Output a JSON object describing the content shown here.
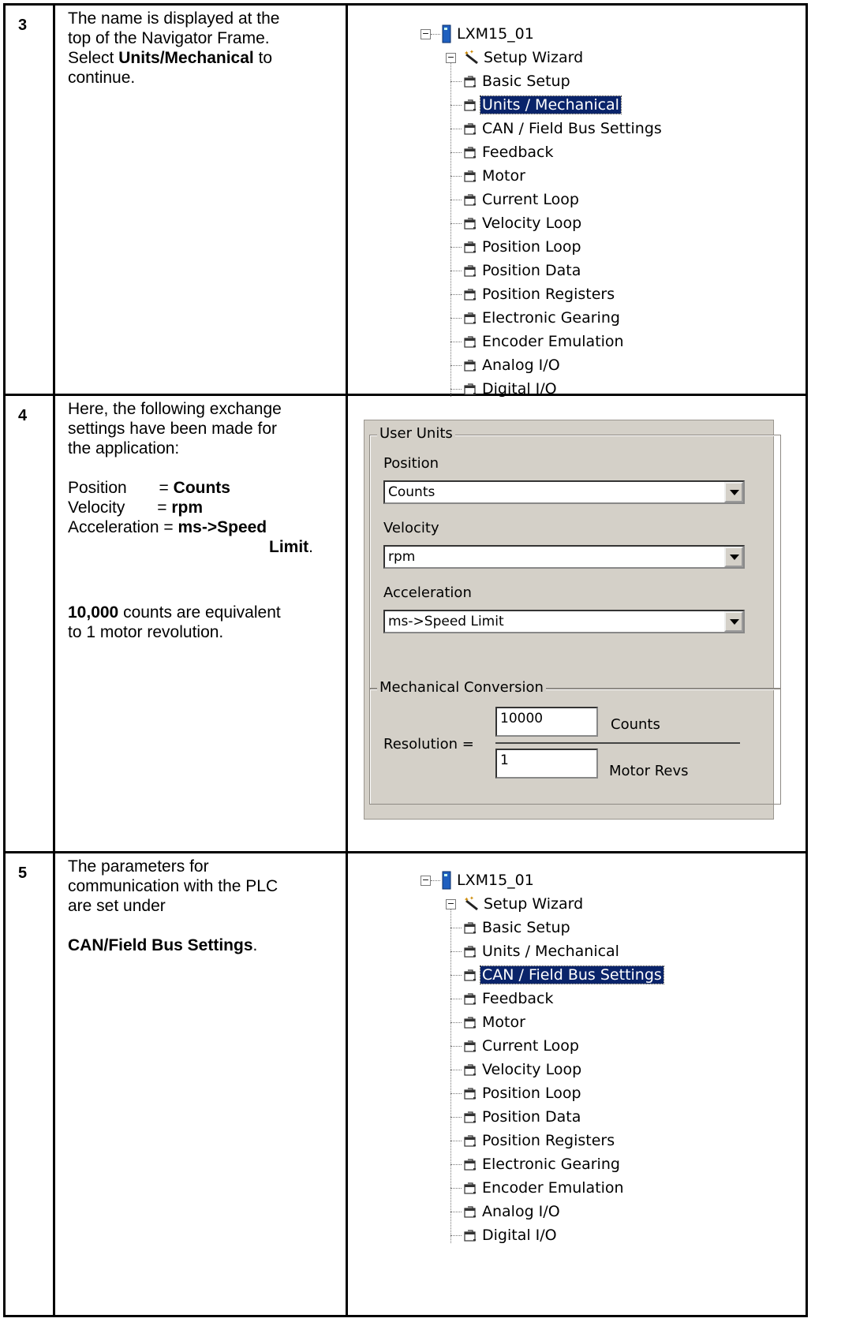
{
  "steps": [
    {
      "number": "3",
      "lines": [
        "The name is displayed at the",
        "top of the Navigator Frame.",
        "Select "
      ],
      "select_bold": "Units/Mechanical",
      "select_after": " to",
      "last": "continue."
    },
    {
      "number": "4",
      "intro": [
        "Here, the following exchange",
        "settings have been made for",
        "the application:"
      ],
      "settings": [
        {
          "key": "Position       = ",
          "value": "Counts"
        },
        {
          "key": "Velocity       = ",
          "value": "rpm"
        },
        {
          "key": "Acceleration = ",
          "value": "ms->Speed"
        }
      ],
      "limit_bold": "Limit",
      "limit_after": ".",
      "counts_bold": "10,000",
      "counts_after": " counts are equivalent",
      "counts_line2": "to 1 motor revolution."
    },
    {
      "number": "5",
      "lines": [
        "The parameters for",
        "communication with the PLC",
        "are set under"
      ],
      "bold": "CAN/Field Bus Settings",
      "after": "."
    }
  ],
  "tree": {
    "root": "LXM15_01",
    "wizard": "Setup Wizard",
    "items": [
      "Basic Setup",
      "Units / Mechanical",
      "CAN / Field Bus Settings",
      "Feedback",
      "Motor",
      "Current Loop",
      "Velocity Loop",
      "Position Loop",
      "Position Data",
      "Position Registers",
      "Electronic Gearing",
      "Encoder Emulation",
      "Analog I/O",
      "Digital I/O"
    ],
    "selected_first": "Units / Mechanical",
    "selected_second": "CAN / Field Bus Settings"
  },
  "user_units": {
    "title": "User Units",
    "position_label": "Position",
    "position_value": "Counts",
    "velocity_label": "Velocity",
    "velocity_value": "rpm",
    "acceleration_label": "Acceleration",
    "acceleration_value": "ms->Speed Limit"
  },
  "mechanical": {
    "title": "Mechanical Conversion",
    "resolution_label": "Resolution  =",
    "counts_value": "10000",
    "counts_label": "Counts",
    "revs_value": "1",
    "revs_label": "Motor Revs"
  },
  "colors": {
    "selection": "#0a246a",
    "panel": "#d4d0c8"
  }
}
